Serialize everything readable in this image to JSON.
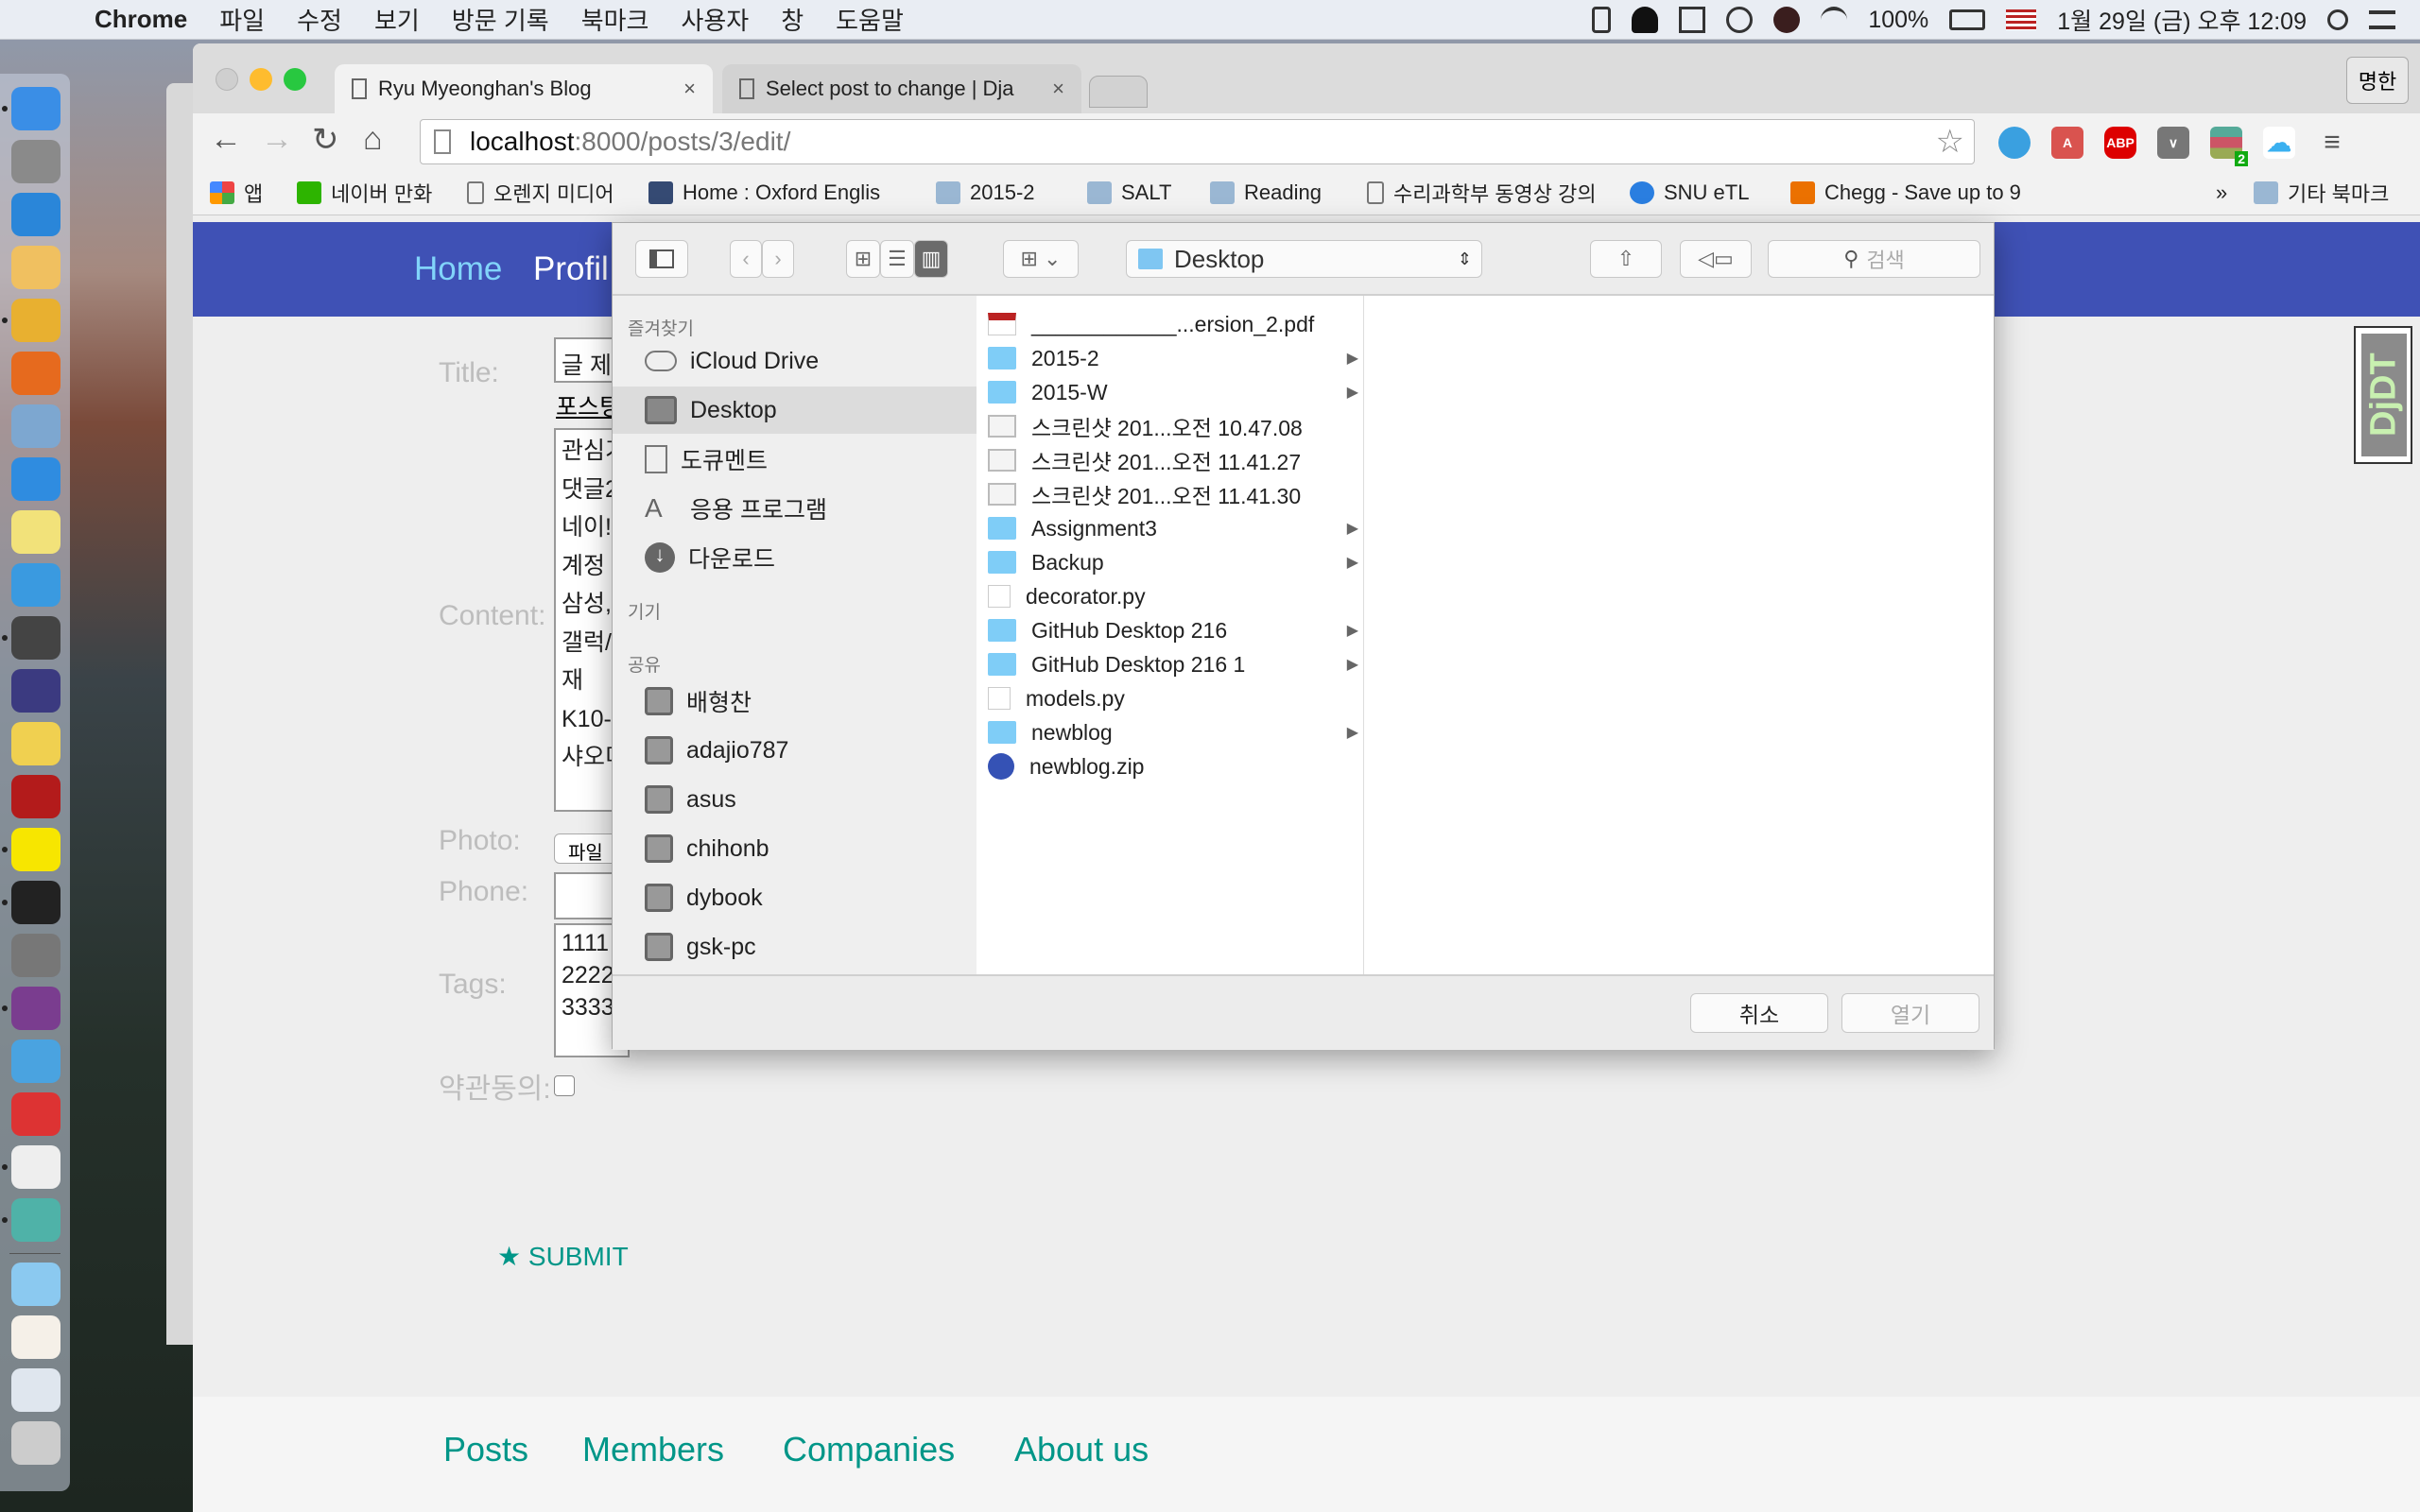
{
  "menubar": {
    "app": "Chrome",
    "items": [
      "파일",
      "수정",
      "보기",
      "방문 기록",
      "북마크",
      "사용자",
      "창",
      "도움말"
    ],
    "battery": "100%",
    "datetime": "1월 29일 (금) 오후 12:09"
  },
  "dock": {
    "apps": [
      "finder",
      "launchpad",
      "safari",
      "textedit",
      "chrome",
      "firefox",
      "mail",
      "app-store",
      "stickies",
      "xcode",
      "sublime-text",
      "eclipse",
      "python-idle",
      "filezilla",
      "kakaotalk",
      "terminal",
      "system-preferences",
      "onenote",
      "maps",
      "parallels",
      "acrobat",
      "slack",
      "applications-folder",
      "home",
      "screenshot",
      "trash"
    ]
  },
  "browser": {
    "tabs": [
      {
        "title": "Ryu Myeonghan's Blog",
        "active": true
      },
      {
        "title": "Select post to change | Dja",
        "active": false
      }
    ],
    "profile": "명한",
    "url_host": "localhost",
    "url_path": ":8000/posts/3/edit/",
    "bookmarks": [
      "앱",
      "네이버 만화",
      "오렌지 미디어",
      "Home : Oxford Englis",
      "2015-2",
      "SALT",
      "Reading",
      "수리과학부 동영상 강의",
      "SNU eTL",
      "Chegg - Save up to 9"
    ],
    "other_bookmarks": "기타 북마크",
    "overflow": "»",
    "extension_badge": "2",
    "abp": "ABP"
  },
  "page": {
    "nav": {
      "home": "Home",
      "profile": "Profil"
    },
    "labels": {
      "title": "Title:",
      "content": "Content:",
      "photo": "Photo:",
      "phone": "Phone:",
      "tags": "Tags:",
      "agree": "약관동의:"
    },
    "title_value": "글 제",
    "help_text": "포스팅",
    "content_lines": [
      "관심기",
      "댓글2",
      "네이!",
      "계정",
      "삼성,",
      "갤럭/",
      "재",
      "K10-",
      "샤오미"
    ],
    "photo_button": "파일",
    "tags_lines": [
      "1111",
      "2222",
      "3333"
    ],
    "submit": "SUBMIT",
    "footer": [
      "Posts",
      "Members",
      "Companies",
      "About us"
    ],
    "djdt": "DjDT",
    "nav_colors": {
      "bar": "#3f51b5",
      "accent": "#009688"
    }
  },
  "dialog": {
    "location": "Desktop",
    "search_placeholder": "검색",
    "sidebar": {
      "favorites_header": "즐겨찾기",
      "favorites": [
        "iCloud Drive",
        "Desktop",
        "도큐멘트",
        "응용 프로그램",
        "다운로드"
      ],
      "devices_header": "기기",
      "shared_header": "공유",
      "shared": [
        "배형찬",
        "adajio787",
        "asus",
        "chihonb",
        "dybook",
        "gsk-pc"
      ]
    },
    "files": [
      {
        "name": "____________...ersion_2.pdf",
        "type": "pdf",
        "folder": false
      },
      {
        "name": "2015-2",
        "type": "folder",
        "folder": true
      },
      {
        "name": "2015-W",
        "type": "folder",
        "folder": true
      },
      {
        "name": "스크린샷 201...오전 10.47.08",
        "type": "image",
        "folder": false
      },
      {
        "name": "스크린샷 201...오전 11.41.27",
        "type": "image",
        "folder": false
      },
      {
        "name": "스크린샷 201...오전 11.41.30",
        "type": "image",
        "folder": false
      },
      {
        "name": "Assignment3",
        "type": "folder",
        "folder": true
      },
      {
        "name": "Backup",
        "type": "folder",
        "folder": true
      },
      {
        "name": "decorator.py",
        "type": "file",
        "folder": false
      },
      {
        "name": "GitHub Desktop 216",
        "type": "folder",
        "folder": true
      },
      {
        "name": "GitHub Desktop 216 1",
        "type": "folder",
        "folder": true
      },
      {
        "name": "models.py",
        "type": "file",
        "folder": false
      },
      {
        "name": "newblog",
        "type": "folder",
        "folder": true
      },
      {
        "name": "newblog.zip",
        "type": "zip",
        "folder": false
      }
    ],
    "cancel": "취소",
    "open": "열기"
  }
}
